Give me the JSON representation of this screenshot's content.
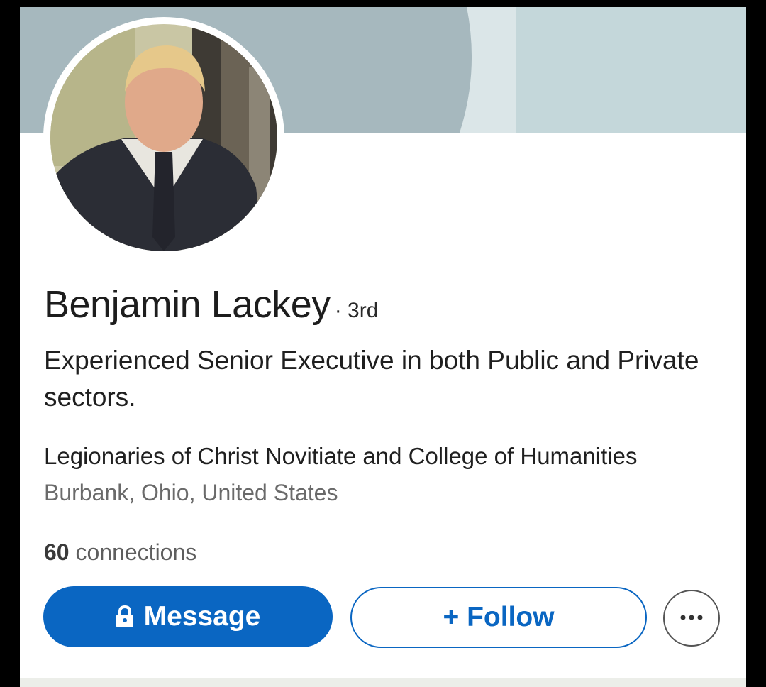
{
  "profile": {
    "name": "Benjamin Lackey",
    "degree": "· 3rd",
    "headline": "Experienced Senior Executive in both Public and Private sectors.",
    "school": "Legionaries of Christ Novitiate and College of Humanities",
    "location": "Burbank, Ohio, United States",
    "connections_count": "60",
    "connections_label": " connections"
  },
  "actions": {
    "message_label": "Message",
    "follow_label": "+ Follow"
  },
  "icons": {
    "message": "lock-icon",
    "more": "more-dots-icon"
  },
  "colors": {
    "accent": "#0a66c2",
    "banner_dark": "#a6b8be",
    "banner_light": "#c4d7da"
  }
}
